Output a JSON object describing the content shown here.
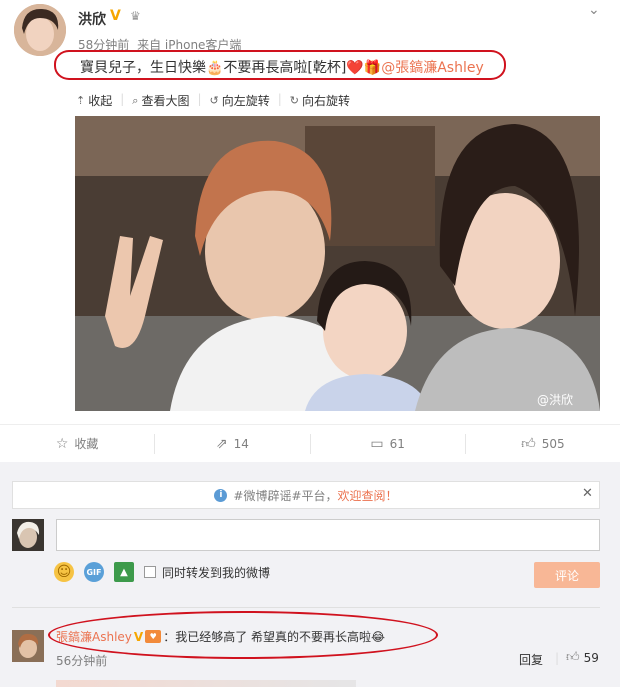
{
  "post": {
    "author": "洪欣",
    "meta_time": "58分钟前",
    "meta_source": "来自 iPhone客户端",
    "text": "寶貝兒子，生日快樂🎂不要再長高啦[乾杯]❤️🎁",
    "mention": "@張鎬濂Ashley",
    "watermark": "@洪欣"
  },
  "toolbar": {
    "collapse": "收起",
    "view_large": "查看大图",
    "rotate_left": "向左旋转",
    "rotate_right": "向右旋转"
  },
  "actions": {
    "favorite": "收藏",
    "forward": "14",
    "comment": "61",
    "like": "505"
  },
  "notice": {
    "prefix": "#微博辟谣#平台，",
    "link": "欢迎查阅！"
  },
  "composer": {
    "input_value": "",
    "also_forward": "同时转发到我的微博",
    "submit": "评论"
  },
  "comment": {
    "user": "張鎬濂Ashley",
    "text": "：我已经够高了 希望真的不要再长高啦😂",
    "time": "56分钟前",
    "reply": "回复",
    "likes": "59"
  },
  "icons": {
    "verified": "v-badge-icon",
    "accent_color": "#eb7350",
    "highlight_color": "#d0121e"
  }
}
